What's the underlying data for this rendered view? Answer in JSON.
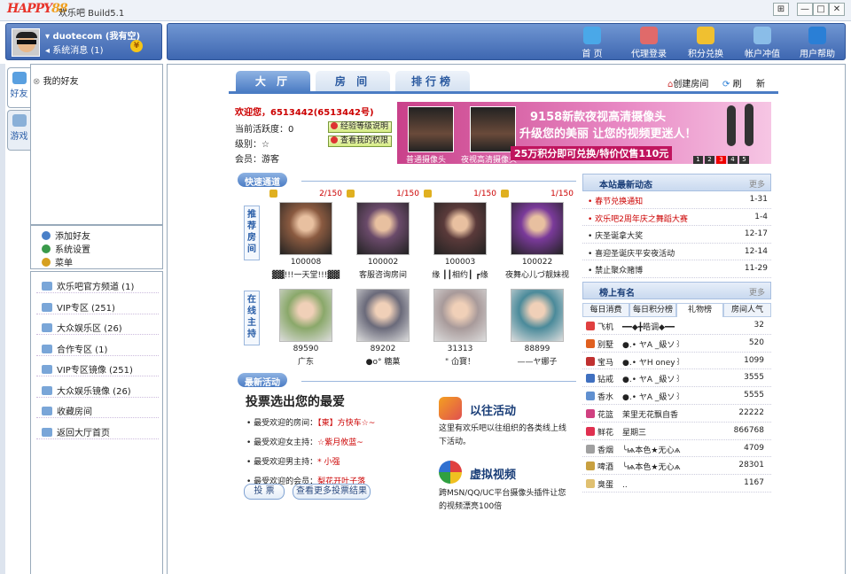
{
  "window": {
    "logo_a": "HAPPY",
    "logo_b": "88",
    "title": "欢乐吧 Build5.1",
    "btn_help": "⊞",
    "btn_min": "—",
    "btn_max": "□",
    "btn_close": "✕"
  },
  "user": {
    "name": "duotecom (我有空)",
    "sysmsg": "系统消息 (1)",
    "coin": "¥"
  },
  "toolbar": [
    {
      "label": "首 页",
      "icon": "monitor-icon",
      "color": "#4aa8e8"
    },
    {
      "label": "代理登录",
      "icon": "agents-icon",
      "color": "#e06a6a"
    },
    {
      "label": "积分兑换",
      "icon": "exchange-icon",
      "color": "#f0c030"
    },
    {
      "label": "帐户冲值",
      "icon": "account-icon",
      "color": "#8abde8"
    },
    {
      "label": "用户帮助",
      "icon": "help-icon",
      "color": "#2a7fd6"
    }
  ],
  "left_tabs": [
    "好友",
    "游戏"
  ],
  "friends": {
    "header": "我的好友"
  },
  "menu": [
    {
      "label": "添加好友",
      "icon": "add-friend-icon",
      "color": "#4a80c8"
    },
    {
      "label": "系统设置",
      "icon": "settings-icon",
      "color": "#3a9a4a"
    },
    {
      "label": "菜单",
      "icon": "menu-icon",
      "color": "#d6a020"
    }
  ],
  "channels": [
    "欢乐吧官方频道 (1)",
    "VIP专区 (251)",
    "大众娱乐区 (26)",
    "合作专区 (1)",
    "VIP专区镜像 (251)",
    "大众娱乐镜像 (26)",
    "收藏房间",
    "返回大厅首页"
  ],
  "main_tabs": [
    "大 厅",
    "房 间",
    "排行榜"
  ],
  "top_links": {
    "create": "创建房间",
    "refresh": "刷",
    "new": "新"
  },
  "welcome": {
    "greet": "欢迎您，6513442(6513442号)",
    "activity": "当前活跃度：0",
    "level": "级别：",
    "level_star": "☆",
    "member": "会员：游客",
    "btn1": "经验等级说明",
    "btn2": "查看我的权限"
  },
  "banner": {
    "line1": "9158新款夜视高清摄像头",
    "line2": "升级您的美丽 让您的视频更迷人！",
    "line3": "25万积分即可兑换/特价仅售110元",
    "cap1": "普通摄像头",
    "cap2": "夜视高清摄像头",
    "nums": [
      "1",
      "2",
      "3",
      "4",
      "5"
    ]
  },
  "quick": {
    "title": "快速通道",
    "tag1": "推荐房间",
    "tag2": "在线主持"
  },
  "rooms": [
    {
      "count": "2/150",
      "id": "100008",
      "name": "▓▓!!!一天堂!!!▓▓",
      "photo": "#8a5a40"
    },
    {
      "count": "1/150",
      "id": "100002",
      "name": "客服咨询房间",
      "photo": "#6a4a6a"
    },
    {
      "count": "1/150",
      "id": "100003",
      "name": "缘 ┃┃相约┃ ┏缘",
      "photo": "#5a3a3a"
    },
    {
      "count": "1/150",
      "id": "100022",
      "name": "夜舞心儿づ靓妹视",
      "photo": "#7a3a9a"
    }
  ],
  "hosts": [
    {
      "id": "89590",
      "name": "广东",
      "photo": "#8aa86a"
    },
    {
      "id": "89202",
      "name": "●o° 糖菓",
      "photo": "#6a6a7a"
    },
    {
      "id": "31313",
      "name": "\" 仚寳！",
      "photo": "#a89a9a"
    },
    {
      "id": "88899",
      "name": "——ヤ娜子",
      "photo": "#4a8a9a"
    }
  ],
  "activity": {
    "title": "最新活动",
    "vote_title": "投票选出您的最爱",
    "items": [
      {
        "label": "• 最受欢迎的房间：",
        "value": "【東】方快车☆~"
      },
      {
        "label": "• 最受欢迎女主持：",
        "value": "☆紫月攸蓝~"
      },
      {
        "label": "• 最受欢迎男主持：",
        "value": "* 小强"
      },
      {
        "label": "• 最受欢迎的会员：",
        "value": "梨花开叶子落"
      }
    ],
    "vote_btn": "投 票",
    "more_btn": "查看更多投票结果",
    "past_title": "以往活动",
    "past_desc": "这里有欢乐吧以往组织的各类线上线下活动。",
    "video_title": "虚拟视频",
    "video_desc": "跨MSN/QQ/UC平台摄像头插件让您的视频漂亮100倍"
  },
  "news": {
    "title": "本站最新动态",
    "more": "更多",
    "items": [
      {
        "text": "• 春节兑换通知",
        "date": "1-31",
        "red": true
      },
      {
        "text": "• 欢乐吧2周年庆之舞蹈大赛",
        "date": "1-4",
        "red": true
      },
      {
        "text": "• 庆圣诞拿大奖",
        "date": "12-17",
        "red": false
      },
      {
        "text": "• 喜迎圣诞庆平安夜活动",
        "date": "12-14",
        "red": false
      },
      {
        "text": "• 禁止聚众赌博",
        "date": "11-29",
        "red": false
      }
    ]
  },
  "ranking": {
    "title": "榜上有名",
    "more": "更多",
    "tabs": [
      "每日消费",
      "每日积分榜",
      "礼物榜",
      "房间人气"
    ],
    "rows": [
      {
        "gift": "飞机",
        "user": "━━◆╋皓调◆━━",
        "value": "32",
        "color": "#e04040"
      },
      {
        "gift": "别墅",
        "user": "●.• ヤA _級ソ꒱",
        "value": "520",
        "color": "#e06020"
      },
      {
        "gift": "宝马",
        "user": "●.• ヤH oney꒱",
        "value": "1099",
        "color": "#c03030"
      },
      {
        "gift": "钻戒",
        "user": "●.• ヤA _級ソ꒱",
        "value": "3555",
        "color": "#4070c0"
      },
      {
        "gift": "香水",
        "user": "●.• ヤA _級ソ꒱",
        "value": "5555",
        "color": "#6090d0"
      },
      {
        "gift": "花篮",
        "user": "茉里无花飘自香",
        "value": "22222",
        "color": "#d04080"
      },
      {
        "gift": "鲜花",
        "user": "星期三",
        "value": "866768",
        "color": "#e03050"
      },
      {
        "gift": "香烟",
        "user": "╰ѩ本色★无心ѧ",
        "value": "4709",
        "color": "#a0a0a0"
      },
      {
        "gift": "啤酒",
        "user": "╰ѩ本色★无心ѧ",
        "value": "28301",
        "color": "#c8a040"
      },
      {
        "gift": "臭蛋",
        "user": "..",
        "value": "1167",
        "color": "#e0c070"
      }
    ]
  }
}
